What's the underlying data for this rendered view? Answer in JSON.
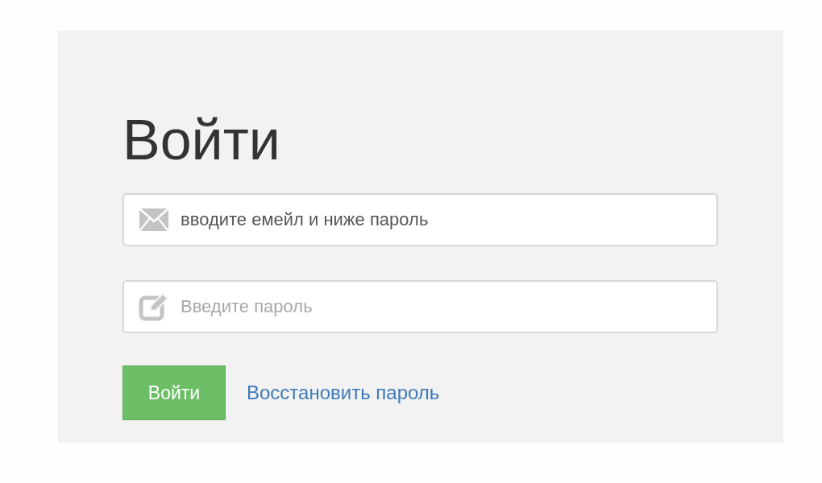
{
  "title": "Войти",
  "fields": [
    {
      "kind": "email",
      "value": "вводите емейл и ниже пароль"
    },
    {
      "kind": "password",
      "placeholder": "Введите пароль"
    }
  ],
  "submit_button": "Войти",
  "recover_link": "Восстановить пароль"
}
